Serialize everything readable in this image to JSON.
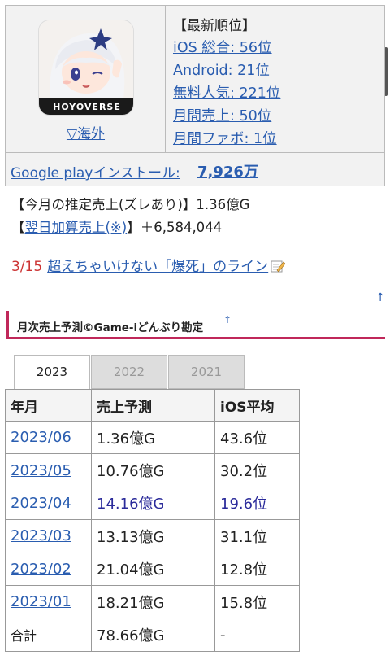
{
  "app": {
    "brand": "HOYOVERSE",
    "region_link": "▽海外",
    "icon_name": "app-character-icon"
  },
  "ranking": {
    "title": "【最新順位】",
    "items": [
      "iOS 総合: 56位",
      "Android: 21位",
      "無料人気: 221位",
      "月間売上: 50位",
      "月間ファボ: 1位"
    ]
  },
  "google_play": {
    "label": "Google playインストール:",
    "value": "7,926万"
  },
  "sales": {
    "estimate_line": "【今月の推定売上(ズレあり)】1.36億G",
    "next_day_prefix": "【",
    "next_day_link": "翌日加算売上(※)",
    "next_day_suffix": "】＋6,584,044"
  },
  "deathline": {
    "date": "3/15",
    "link": "超えちゃいけない「爆死」のライン"
  },
  "nav": {
    "up_arrow": "↑"
  },
  "section": {
    "title": "月次売上予測©Game-iどんぶり勘定",
    "up": "↑"
  },
  "tabs": [
    "2023",
    "2022",
    "2021"
  ],
  "table": {
    "headers": [
      "年月",
      "売上予測",
      "iOS平均"
    ],
    "rows": [
      {
        "month": "2023/06",
        "sales": "1.36億G",
        "ios": "43.6位"
      },
      {
        "month": "2023/05",
        "sales": "10.76億G",
        "ios": "30.2位"
      },
      {
        "month": "2023/04",
        "sales": "14.16億G",
        "ios": "19.6位"
      },
      {
        "month": "2023/03",
        "sales": "13.13億G",
        "ios": "31.1位"
      },
      {
        "month": "2023/02",
        "sales": "21.04億G",
        "ios": "12.8位"
      },
      {
        "month": "2023/01",
        "sales": "18.21億G",
        "ios": "15.8位"
      }
    ],
    "total": {
      "label": "合計",
      "sales": "78.66億G",
      "ios": "-"
    }
  },
  "colors": {
    "link": "#2a5db0",
    "accent": "#c0285a",
    "date_red": "#cc3333",
    "highlight_row": "#2a2a9a"
  }
}
